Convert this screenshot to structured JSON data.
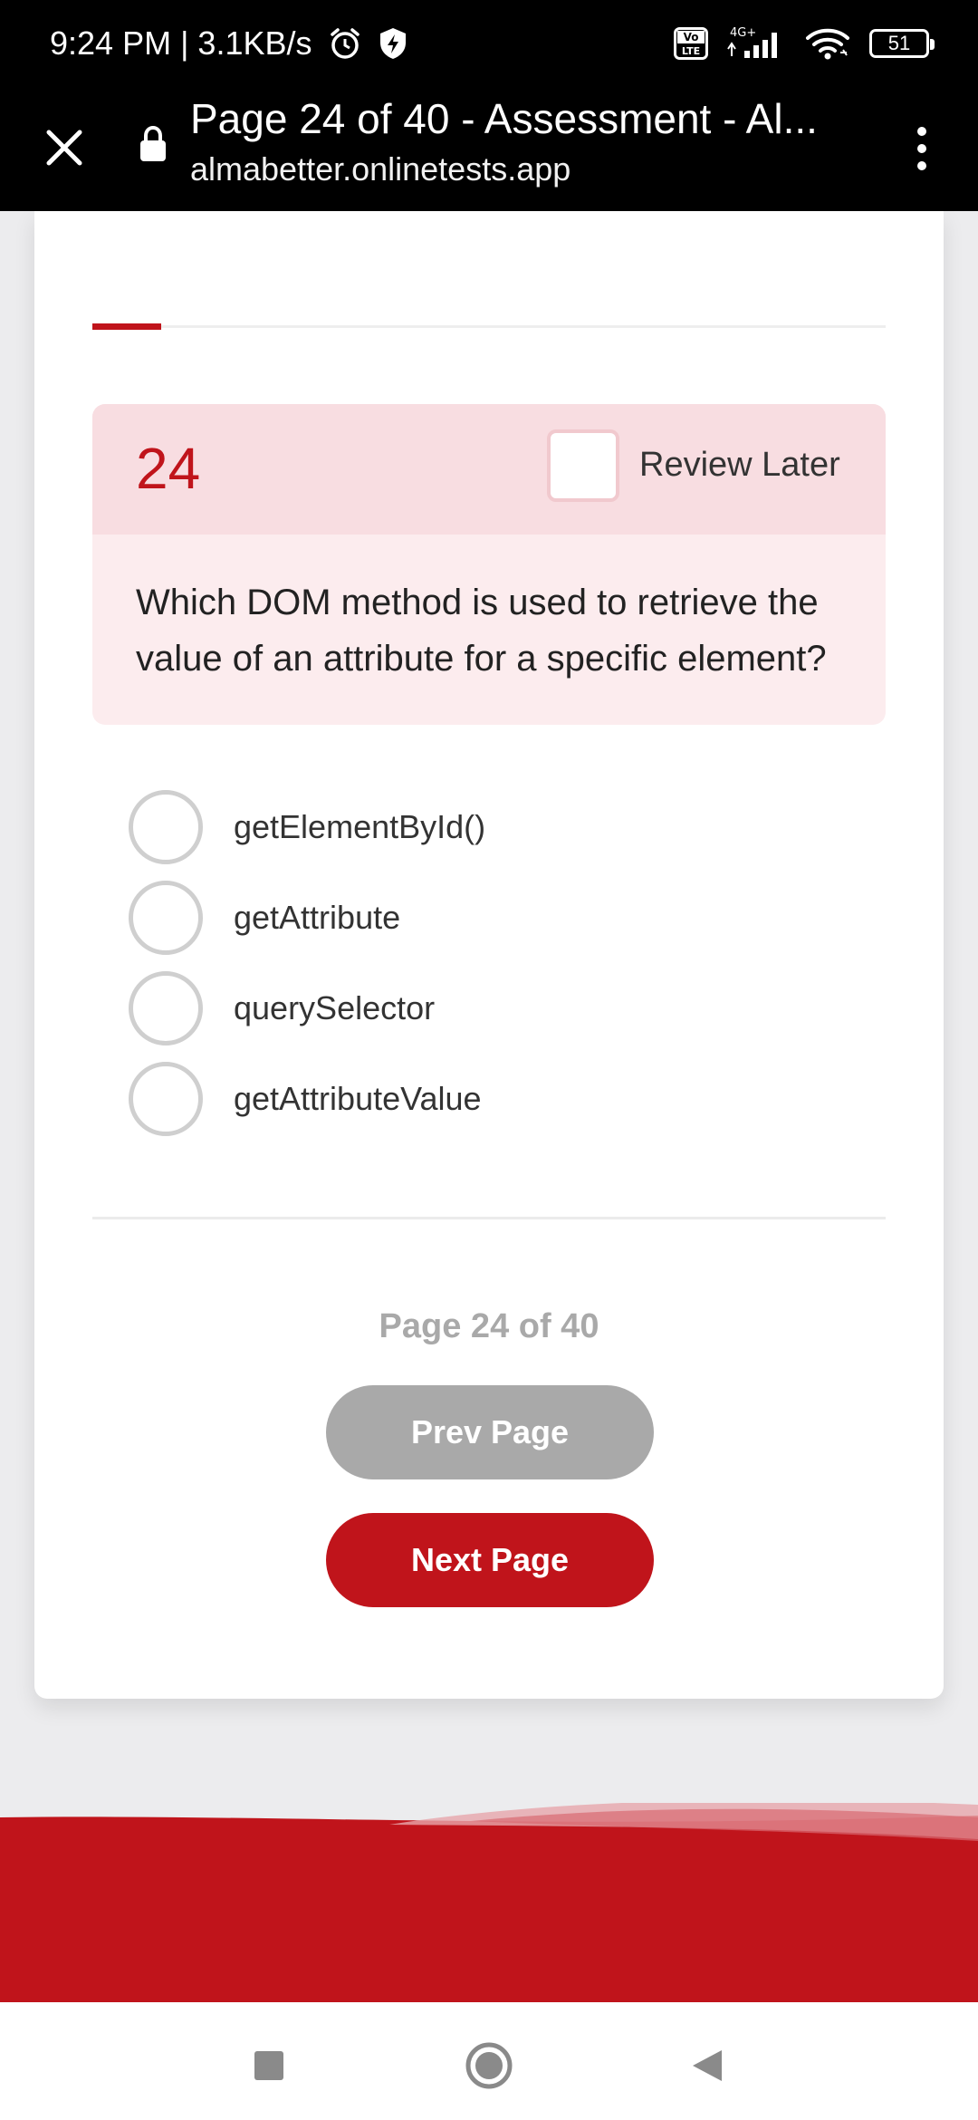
{
  "status_bar": {
    "time_speed": "9:24 PM | 3.1KB/s",
    "network_label": "4G+",
    "volte_label": "Vo LTE",
    "battery": "51",
    "icons": [
      "alarm-icon",
      "shield-bolt-icon",
      "volte-icon",
      "signal-icon",
      "wifi-icon",
      "battery-icon"
    ]
  },
  "browser": {
    "title": "Page 24 of 40 - Assessment - Al...",
    "url": "almabetter.onlinetests.app"
  },
  "quiz": {
    "progress_fraction": 0.087,
    "question_number": "24",
    "review_later_label": "Review Later",
    "question_text": "Which DOM method is used to retrieve the value of an attribute for a specific element?",
    "options": [
      "getElementById()",
      "getAttribute",
      "querySelector",
      "getAttributeValue"
    ],
    "page_indicator": "Page 24 of 40",
    "prev_label": "Prev Page",
    "next_label": "Next Page"
  },
  "colors": {
    "accent": "#c0141b",
    "header_tint": "#f8dde1",
    "body_tint": "#fcecee",
    "disabled": "#a9a9a9"
  }
}
